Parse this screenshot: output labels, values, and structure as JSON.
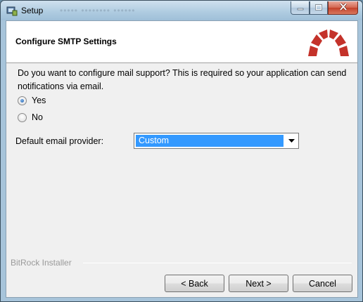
{
  "window": {
    "title": "Setup",
    "title_ghost": "••••• •••••••• ••••••"
  },
  "header": {
    "title": "Configure SMTP Settings",
    "logo_icon": "redmine-logo-icon",
    "logo_color": "#c4322a"
  },
  "main": {
    "question": "Do you want to configure mail support? This is required so your application can send notifications via email.",
    "options": [
      {
        "label": "Yes",
        "checked": true
      },
      {
        "label": "No",
        "checked": false
      }
    ],
    "provider_label": "Default email provider:",
    "provider_selected": "Custom"
  },
  "footer": {
    "installer_label": "BitRock Installer",
    "back_label": "< Back",
    "next_label": "Next >",
    "cancel_label": "Cancel"
  },
  "colors": {
    "selection": "#3399ff",
    "close_button": "#c4412a"
  }
}
